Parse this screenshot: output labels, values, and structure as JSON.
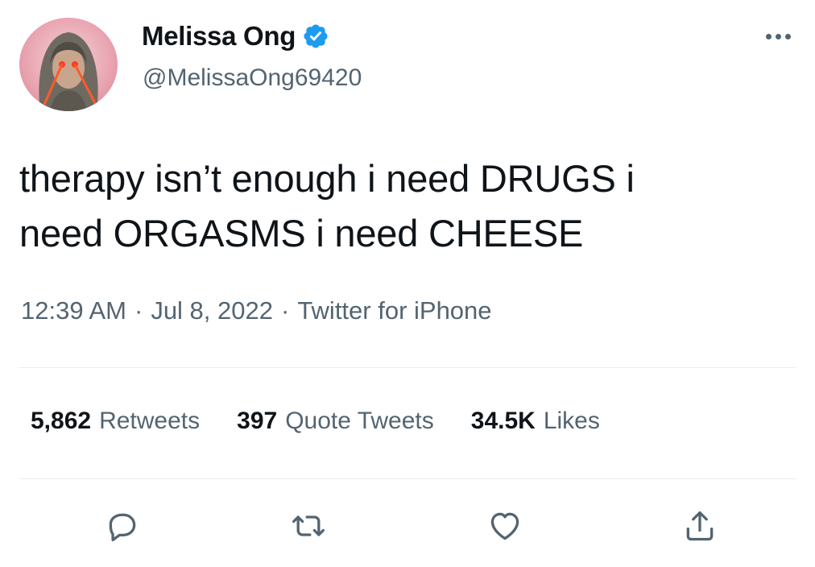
{
  "author": {
    "display_name": "Melissa Ong",
    "handle": "@MelissaOng69420",
    "verified_icon": "verified-badge-icon",
    "accent_color": "#1d9bf0"
  },
  "tweet": {
    "text": "therapy isn’t enough i need DRUGS i\nneed ORGASMS i need CHEESE",
    "time": "12:39 AM",
    "separator": "·",
    "date": "Jul 8, 2022",
    "source": "Twitter for iPhone"
  },
  "stats": {
    "retweets": {
      "count": "5,862",
      "label": "Retweets"
    },
    "quote_tweets": {
      "count": "397",
      "label": "Quote Tweets"
    },
    "likes": {
      "count": "34.5K",
      "label": "Likes"
    }
  },
  "actions": [
    "reply-icon",
    "retweet-icon",
    "like-icon",
    "share-icon"
  ],
  "colors": {
    "text": "#0f1419",
    "secondary": "#536471",
    "divider": "#e6ecf0"
  }
}
